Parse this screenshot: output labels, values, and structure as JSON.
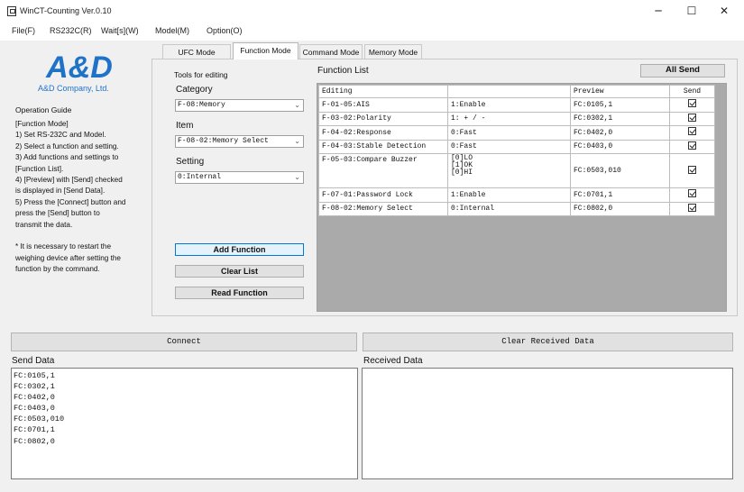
{
  "window": {
    "title": "WinCT-Counting Ver.0.10",
    "minimize_glyph": "─",
    "maximize_glyph": "☐",
    "close_glyph": "✕"
  },
  "menu": [
    "File(F)",
    "RS232C(R)",
    "Wait[s](W)",
    "Model(M)",
    "Option(O)"
  ],
  "sidebar": {
    "logo_text": "A&D",
    "company": "A&D Company, Ltd.",
    "guide_title": "Operation Guide",
    "guide_text": "[Function Mode]\n1) Set RS-232C and Model.\n2) Select a function and setting.\n3) Add functions and settings to\n[Function List].\n4) [Preview] with [Send] checked\nis displayed in [Send Data].\n5) Press the [Connect] button and\npress the [Send] button to\ntransmit the data.\n\n* It is necessary to restart the\nweighing device after setting the\nfunction by the command."
  },
  "tabs": [
    "UFC Mode",
    "Function Mode",
    "Command Mode",
    "Memory Mode"
  ],
  "editor": {
    "tools_label": "Tools for editing",
    "category_label": "Category",
    "category_value": "F-08:Memory",
    "item_label": "Item",
    "item_value": "F-08-02:Memory Select",
    "setting_label": "Setting",
    "setting_value": "0:Internal",
    "add_button": "Add Function",
    "clear_button": "Clear List",
    "read_button": "Read Function"
  },
  "function_list": {
    "title": "Function List",
    "all_send": "All Send",
    "columns": [
      "Editing",
      "",
      "Preview",
      "Send"
    ],
    "rows": [
      {
        "editing": "F-01-05:AIS",
        "setting": "1:Enable",
        "preview": "FC:0105,1",
        "send": true
      },
      {
        "editing": "F-03-02:Polarity",
        "setting": "1: + / -",
        "preview": "FC:0302,1",
        "send": true
      },
      {
        "editing": "F-04-02:Response",
        "setting": "0:Fast",
        "preview": "FC:0402,0",
        "send": true
      },
      {
        "editing": "F-04-03:Stable Detection",
        "setting": "0:Fast",
        "preview": "FC:0403,0",
        "send": true
      },
      {
        "editing": "F-05-03:Compare Buzzer",
        "setting": "[0]LO\n[1]OK\n[0]HI",
        "preview": "FC:0503,010",
        "send": true
      },
      {
        "editing": "F-07-01:Password Lock",
        "setting": "1:Enable",
        "preview": "FC:0701,1",
        "send": true
      },
      {
        "editing": "F-08-02:Memory Select",
        "setting": "0:Internal",
        "preview": "FC:0802,0",
        "send": true
      }
    ]
  },
  "bottom": {
    "connect": "Connect",
    "clear_received": "Clear Received Data",
    "send_label": "Send Data",
    "received_label": "Received Data",
    "send_data": "FC:0105,1\nFC:0302,1\nFC:0402,0\nFC:0403,0\nFC:0503,010\nFC:0701,1\nFC:0802,0",
    "received_data": ""
  },
  "colors": {
    "brand_blue": "#1e73c8",
    "focus_border": "#0078d7"
  }
}
